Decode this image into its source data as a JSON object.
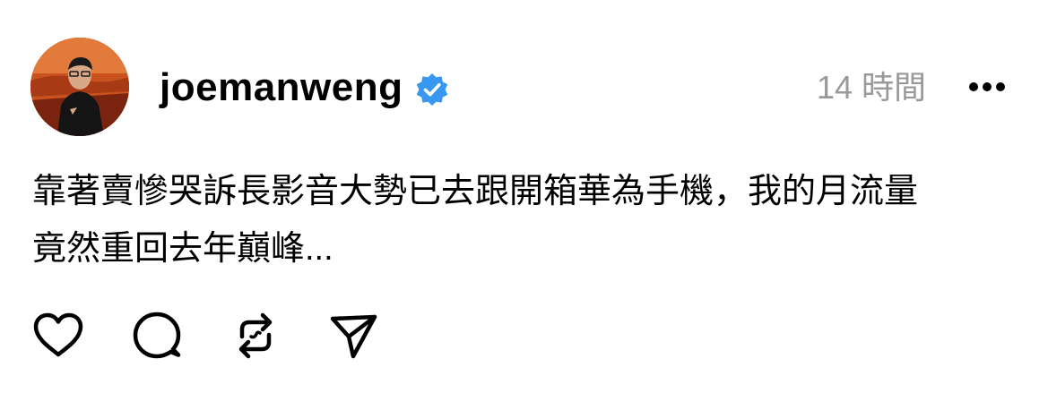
{
  "post": {
    "username": "joemanweng",
    "verified": true,
    "timestamp": "14 時間",
    "caption_lines": [
      "靠著賣慘哭訴長影音大勢已去跟開箱華為手機，我的月流量",
      "竟然重回去年巔峰..."
    ]
  },
  "actions": {
    "icons": [
      "heart-icon",
      "comment-icon",
      "repost-icon",
      "share-icon"
    ]
  },
  "colors": {
    "verified_badge": "#3897f0",
    "timestamp": "#999999",
    "text": "#000000"
  }
}
